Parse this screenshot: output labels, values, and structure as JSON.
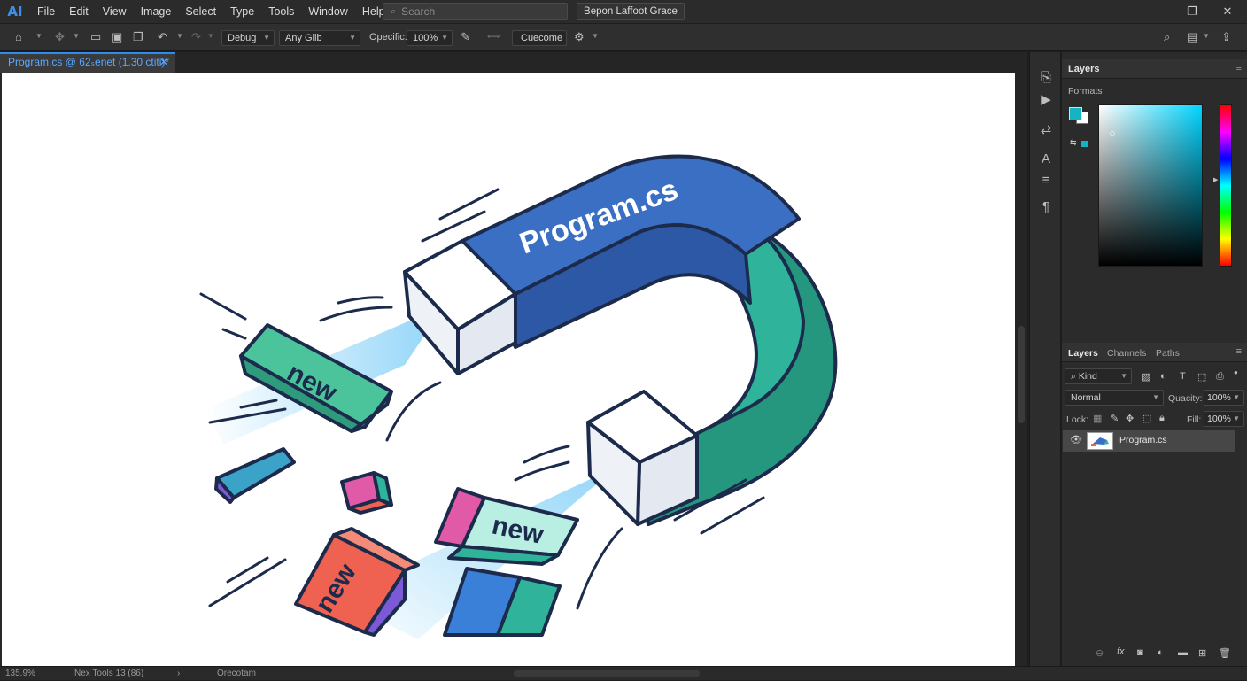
{
  "app": {
    "logo": "AI"
  },
  "menu": [
    "File",
    "Edit",
    "View",
    "Image",
    "Select",
    "Type",
    "Tools",
    "Window",
    "Help"
  ],
  "search": {
    "placeholder": "Search"
  },
  "workspace": {
    "label": "Bepon Laffoot Grace"
  },
  "window_controls": {
    "minimize": "—",
    "restore": "❐",
    "close": "✕"
  },
  "options_bar": {
    "mode_select": "Debug",
    "target_select": "Any Gilb",
    "opacity_label": "Opecific:",
    "opacity_value": "100%",
    "action_button": "Cuecome"
  },
  "document": {
    "tab_title": "Program.cs @ 62ₛenet (1.30 ctiti)*",
    "tab_close": "✕"
  },
  "artwork": {
    "magnet_label": "Program.cs",
    "block_labels": [
      "new",
      "new",
      "new"
    ],
    "colors": {
      "magnet_blue": "#3a6fc4",
      "magnet_blue_dark": "#2d58a6",
      "magnet_teal": "#2fb39a",
      "magnet_teal_dark": "#26977f",
      "outline": "#1c2b4b",
      "beam": "#5bc0f5",
      "block_teal": "#4cc49b",
      "block_coral": "#ef6150",
      "block_purple": "#7c59d6",
      "block_pink": "#e05aa8",
      "block_mint": "#b9efe3"
    }
  },
  "status_bar": {
    "zoom": "135.9%",
    "info": "Nex Tools 13 (86)",
    "arrow": "›",
    "mode": "Orecotam"
  },
  "side_strip": {
    "icons": [
      "history-icon",
      "play-icon",
      "adjustments-icon",
      "character-icon",
      "paragraph-align-icon",
      "pilcrow-icon"
    ]
  },
  "color_panel": {
    "title": "Layers",
    "subtitle": "Formats",
    "foreground_color": "#16b3c2",
    "background_color": "#ffffff"
  },
  "layers_panel": {
    "tabs": [
      "Layers",
      "Channels",
      "Paths"
    ],
    "filter_kind": "Kind",
    "blend_mode": "Normal",
    "quality_label": "Quacity:",
    "quality_value": "100%",
    "lock_label": "Lock:",
    "fill_label": "Fill:",
    "fill_value": "100%",
    "layer_name": "Program.cs"
  }
}
